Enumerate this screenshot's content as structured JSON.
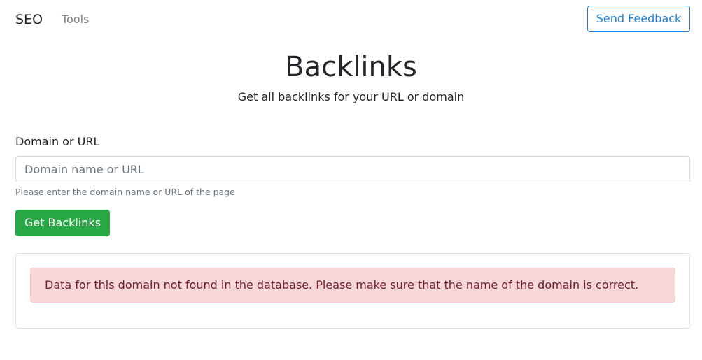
{
  "navbar": {
    "brand": "SEO",
    "links": [
      {
        "label": "Tools"
      }
    ],
    "feedback_label": "Send Feedback"
  },
  "header": {
    "title": "Backlinks",
    "subtitle": "Get all backlinks for your URL or domain"
  },
  "form": {
    "label": "Domain or URL",
    "input_value": "",
    "input_placeholder": "Domain name or URL",
    "help_text": "Please enter the domain name or URL of the page",
    "submit_label": "Get Backlinks"
  },
  "result": {
    "alert_message": "Data for this domain not found in the database. Please make sure that the name of the domain is correct."
  },
  "colors": {
    "primary": "#1e7fd8",
    "success": "#28a745",
    "danger_bg": "#f8d7da",
    "danger_text": "#721c24"
  }
}
